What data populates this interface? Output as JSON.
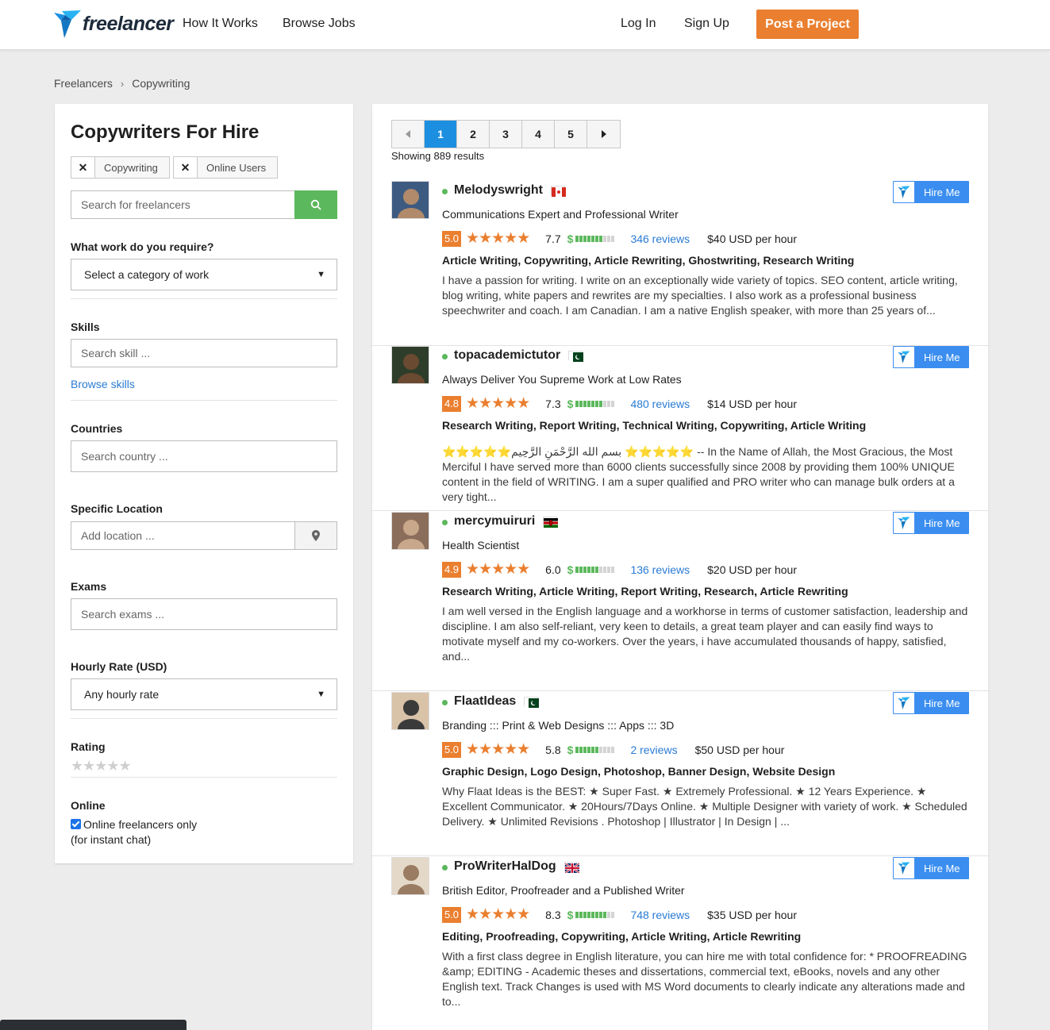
{
  "header": {
    "logo_text": "freelancer",
    "nav": [
      "How It Works",
      "Browse Jobs"
    ],
    "login": "Log In",
    "signup": "Sign Up",
    "post_project": "Post a Project"
  },
  "breadcrumb": [
    "Freelancers",
    "Copywriting"
  ],
  "sidebar": {
    "title": "Copywriters For Hire",
    "chips": [
      "Copywriting",
      "Online Users"
    ],
    "search_placeholder": "Search for freelancers",
    "work_label": "What work do you require?",
    "work_select": "Select a category of work",
    "skills_label": "Skills",
    "skills_placeholder": "Search skill ...",
    "browse_skills": "Browse skills",
    "countries_label": "Countries",
    "countries_placeholder": "Search country ...",
    "location_label": "Specific Location",
    "location_placeholder": "Add location ...",
    "exams_label": "Exams",
    "exams_placeholder": "Search exams ...",
    "rate_label": "Hourly Rate (USD)",
    "rate_select": "Any hourly rate",
    "rating_label": "Rating",
    "online_label": "Online",
    "online_check_1": "Online freelancers only",
    "online_check_2": "(for instant chat)"
  },
  "pagination": {
    "pages": [
      "1",
      "2",
      "3",
      "4",
      "5"
    ],
    "current": "1",
    "results": "Showing 889 results"
  },
  "hire_label": "Hire Me",
  "freelancers": [
    {
      "name": "Melodyswright",
      "country_flag": "canada",
      "tagline": "Communications Expert and Professional Writer",
      "score": "5.0",
      "earnings": "7.7",
      "earn_level": 0.7,
      "reviews": "346 reviews",
      "rate": "$40 USD per hour",
      "skills": "Article Writing, Copywriting, Article Rewriting, Ghostwriting, Research Writing",
      "description": "I have a passion for writing. I write on an exceptionally wide variety of topics. SEO content, article writing, blog writing, white papers and rewrites are my specialties. I also work as a professional business speechwriter and coach. I am Canadian. I am a native English speaker, with more than 25 years of..."
    },
    {
      "name": "topacademictutor",
      "country_flag": "pakistan",
      "tagline": "Always Deliver You Supreme Work at Low Rates",
      "score": "4.8",
      "earnings": "7.3",
      "earn_level": 0.7,
      "reviews": "480 reviews",
      "rate": "$14 USD per hour",
      "skills": "Research Writing, Report Writing, Technical Writing, Copywriting, Article Writing",
      "description": "⭐⭐⭐⭐⭐بسم الله الرَّحْمَنِ الرَّحِيم ⭐⭐⭐⭐⭐ -- In the Name of Allah, the Most Gracious, the Most Merciful I have served more than 6000 clients successfully since 2008 by providing them 100% UNIQUE content in the field of WRITING. I am a super qualified and PRO writer who can manage bulk orders at a very tight..."
    },
    {
      "name": "mercymuiruri",
      "country_flag": "kenya",
      "tagline": "Health Scientist",
      "score": "4.9",
      "earnings": "6.0",
      "earn_level": 0.6,
      "reviews": "136 reviews",
      "rate": "$20 USD per hour",
      "skills": "Research Writing, Article Writing, Report Writing, Research, Article Rewriting",
      "description": "I am well versed in the English language and a workhorse in terms of customer satisfaction, leadership and discipline. I am also self-reliant, very keen to details, a great team player and can easily find ways to motivate myself and my co-workers. Over the years, i have accumulated thousands of happy, satisfied, and..."
    },
    {
      "name": "FlaatIdeas",
      "country_flag": "pakistan",
      "tagline": "Branding ::: Print & Web Designs ::: Apps ::: 3D",
      "score": "5.0",
      "earnings": "5.8",
      "earn_level": 0.6,
      "reviews": "2 reviews",
      "rate": "$50 USD per hour",
      "skills": "Graphic Design, Logo Design, Photoshop, Banner Design, Website Design",
      "description": "Why Flaat Ideas is the BEST: ★ Super Fast. ★ Extremely Professional. ★ 12 Years Experience. ★ Excellent Communicator. ★ 20Hours/7Days Online. ★ Multiple Designer with variety of work. ★ Scheduled Delivery. ★ Unlimited Revisions . Photoshop | Illustrator | In Design | ..."
    },
    {
      "name": "ProWriterHalDog",
      "country_flag": "uk",
      "tagline": "British Editor, Proofreader and a Published Writer",
      "score": "5.0",
      "earnings": "8.3",
      "earn_level": 0.8,
      "reviews": "748 reviews",
      "rate": "$35 USD per hour",
      "skills": "Editing, Proofreading, Copywriting, Article Writing, Article Rewriting",
      "description": "With a first class degree in English literature, you can hire me with total confidence for: * PROOFREADING &amp; EDITING - Academic theses and dissertations, commercial text, eBooks, novels and any other English text. Track Changes is used with MS Word documents to clearly indicate any alterations made and to..."
    }
  ],
  "colors": {
    "brand_orange": "#ea7f2f",
    "hire_blue": "#3b8ef0",
    "search_green": "#5cb85c",
    "link_blue": "#2a7bd4"
  }
}
